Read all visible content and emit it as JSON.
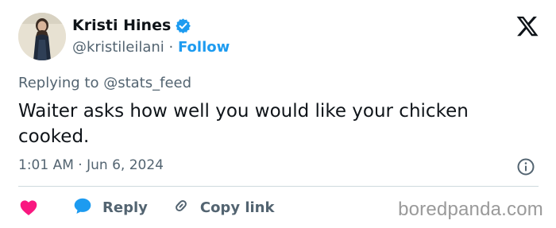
{
  "author": {
    "name": "Kristi Hines",
    "handle": "@kristileilani",
    "separator": "·",
    "follow_label": "Follow"
  },
  "tweet": {
    "replying_to": "Replying to @stats_feed",
    "text": "Waiter asks how well you would like your chicken cooked.",
    "time": "1:01 AM",
    "meta_separator": "·",
    "date": "Jun 6, 2024"
  },
  "actions": {
    "reply_label": "Reply",
    "copy_link_label": "Copy link"
  },
  "watermark": "boredpanda.com",
  "colors": {
    "accent": "#1d9bf0",
    "heart": "#f91880",
    "text": "#0f1419",
    "muted": "#536471"
  }
}
